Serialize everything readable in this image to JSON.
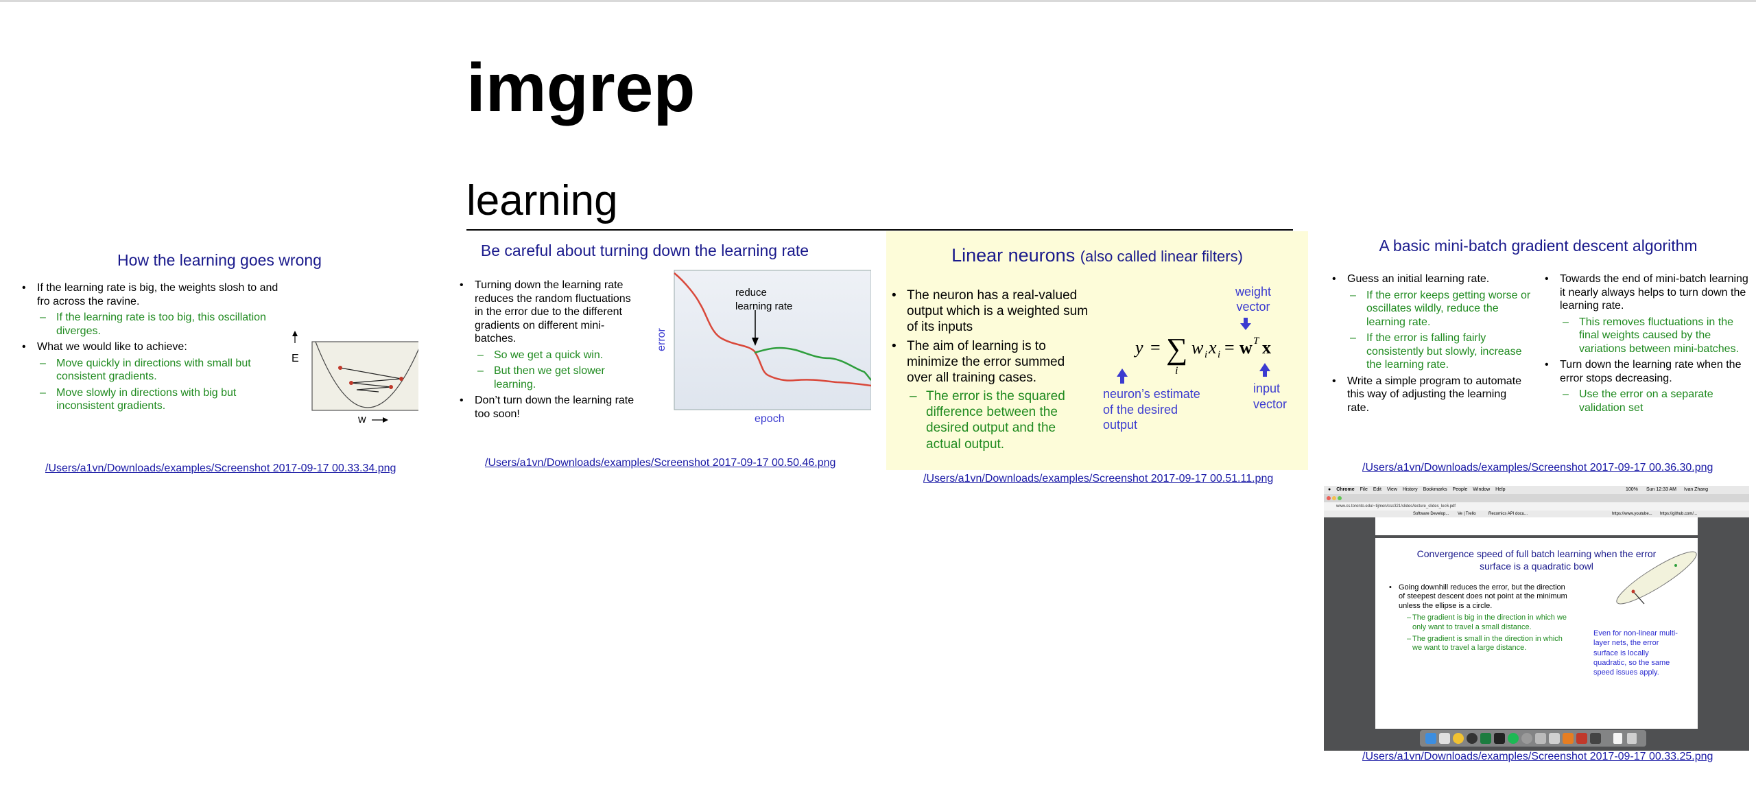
{
  "page": {
    "title": "imgrep",
    "section": "learning"
  },
  "results": [
    {
      "title": "How the learning goes wrong",
      "bullets": [
        {
          "text": "If the learning rate is big, the weights slosh to and fro across the ravine.",
          "level": 0
        },
        {
          "text": "If the learning rate is too big, this oscillation diverges.",
          "level": 1
        },
        {
          "text": "What we would like to achieve:",
          "level": 0
        },
        {
          "text": "Move quickly in directions with small but consistent gradients.",
          "level": 1
        },
        {
          "text": "Move slowly in directions with big but inconsistent gradients.",
          "level": 1
        }
      ],
      "figure": {
        "axis_y": "E",
        "axis_x": "w"
      },
      "caption": "/Users/a1vn/Downloads/examples/Screenshot 2017-09-17 00.33.34.png"
    },
    {
      "title": "Be careful about turning down the learning rate",
      "bullets": [
        {
          "text": "Turning down the learning rate reduces the random fluctuations in the error due to the different gradients on different mini-batches.",
          "level": 0
        },
        {
          "text": "So we get a quick win.",
          "level": 1
        },
        {
          "text": "But then we get slower learning.",
          "level": 1
        },
        {
          "text": "Don’t turn down the learning rate too soon!",
          "level": 0
        }
      ],
      "figure": {
        "ylabel": "error",
        "xlabel": "epoch",
        "annotation": "reduce learning rate"
      },
      "caption": "/Users/a1vn/Downloads/examples/Screenshot 2017-09-17 00.50.46.png"
    },
    {
      "title": "Linear neurons",
      "title_note": "(also called linear filters)",
      "bullets": [
        {
          "text": "The neuron has a real-valued output which is a weighted sum of its inputs",
          "level": 0
        },
        {
          "text": "The aim of learning is to minimize the error summed over all training cases.",
          "level": 0
        },
        {
          "text": "The error is the squared difference between the desired output and the actual output.",
          "level": 1
        }
      ],
      "figure": {
        "weight_label": "weight vector",
        "estimate_label": "neuron’s estimate of the desired output",
        "input_label": "input vector"
      },
      "caption": "/Users/a1vn/Downloads/examples/Screenshot 2017-09-17 00.51.11.png"
    },
    {
      "title": "A basic mini-batch gradient descent algorithm",
      "left_bullets": [
        {
          "text": "Guess an initial learning rate.",
          "level": 0
        },
        {
          "text": "If the error keeps getting worse or oscillates wildly, reduce the learning rate.",
          "level": 1
        },
        {
          "text": "If the error is falling fairly consistently but slowly, increase the learning rate.",
          "level": 1
        },
        {
          "text": "Write a simple program to automate this way of adjusting the learning rate.",
          "level": 0
        }
      ],
      "right_bullets": [
        {
          "text": "Towards the end of mini-batch learning it nearly always helps to turn down the learning rate.",
          "level": 0
        },
        {
          "text": "This removes fluctuations in the final weights caused by the variations between mini-batches.",
          "level": 1
        },
        {
          "text": "Turn down the learning rate when the error stops decreasing.",
          "level": 0
        },
        {
          "text": "Use the error on a separate validation set",
          "level": 1
        }
      ],
      "caption": "/Users/a1vn/Downloads/examples/Screenshot 2017-09-17 00.36.30.png"
    },
    {
      "menubar": [
        "Chrome",
        "File",
        "Edit",
        "View",
        "History",
        "Bookmarks",
        "People",
        "Window",
        "Help"
      ],
      "clock": "Sun 12:33 AM",
      "user": "Ivan Zhang",
      "battery": "100%",
      "url": "www.cs.toronto.edu/~tijmen/csc321/slides/lecture_slides_lec6.pdf",
      "bookmarks": [
        "Software Develop...",
        "Ve | Trello",
        "Recomics API docu...",
        "https://www.youtube...",
        "https://github.com/..."
      ],
      "slide_title": "Convergence speed of full batch learning when the error surface is a quadratic bowl",
      "bullets": [
        {
          "text": "Going downhill reduces the error, but the direction of steepest descent does not point at the minimum unless the ellipse is a circle.",
          "level": 0
        },
        {
          "text": "The gradient is big in the direction in which we only want to travel a small distance.",
          "level": 1
        },
        {
          "text": "The gradient is small in the direction in which we want to travel a large distance.",
          "level": 1
        }
      ],
      "side_note": "Even for non-linear multi-layer nets, the error surface is locally quadratic, so the same speed issues apply.",
      "caption": "/Users/a1vn/Downloads/examples/Screenshot 2017-09-17 00.33.25.png"
    }
  ],
  "colors": {
    "slide_title": "#1a1a8c",
    "green_text": "#1f8a1f",
    "link": "#1a1aa6",
    "highlight_bg": "#fdfcd9",
    "red_curve": "#d9483a",
    "green_curve": "#2e9e3c"
  }
}
